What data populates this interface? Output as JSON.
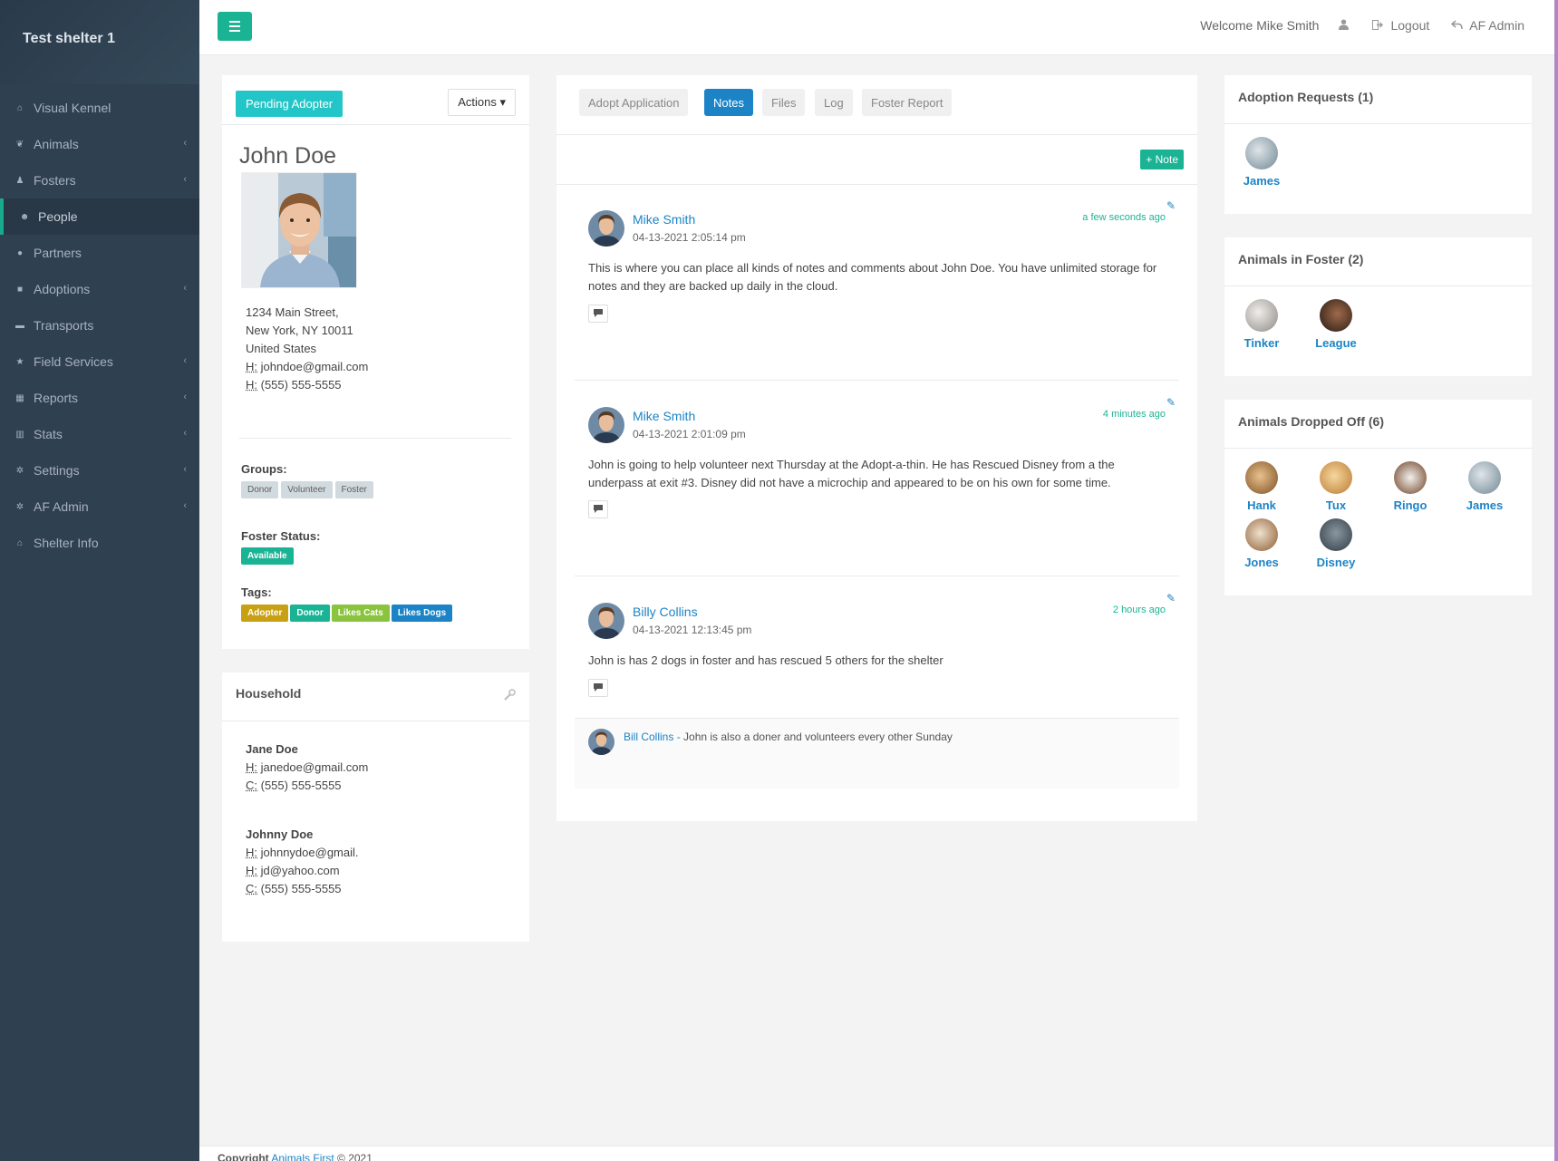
{
  "app": {
    "title": "Test shelter 1"
  },
  "sidebar": {
    "items": [
      {
        "label": "Visual Kennel",
        "icon": "home-icon",
        "caret": false
      },
      {
        "label": "Animals",
        "icon": "paw-icon",
        "caret": true
      },
      {
        "label": "Fosters",
        "icon": "child-icon",
        "caret": true
      },
      {
        "label": "People",
        "icon": "users-icon",
        "caret": false,
        "active": true
      },
      {
        "label": "Partners",
        "icon": "user-icon",
        "caret": false
      },
      {
        "label": "Adoptions",
        "icon": "gift-icon",
        "caret": true
      },
      {
        "label": "Transports",
        "icon": "truck-icon",
        "caret": false
      },
      {
        "label": "Field Services",
        "icon": "star-icon",
        "caret": true
      },
      {
        "label": "Reports",
        "icon": "table-icon",
        "caret": true
      },
      {
        "label": "Stats",
        "icon": "bar-chart-icon",
        "caret": true
      },
      {
        "label": "Settings",
        "icon": "gear-icon",
        "caret": true
      },
      {
        "label": "AF Admin",
        "icon": "gear-icon",
        "caret": true
      },
      {
        "label": "Shelter Info",
        "icon": "home-icon",
        "caret": false
      }
    ]
  },
  "topbar": {
    "welcome": "Welcome Mike Smith",
    "logout": "Logout",
    "admin": "AF Admin"
  },
  "profile": {
    "status": "Pending Adopter",
    "actions": "Actions",
    "name": "John Doe",
    "address": {
      "line1": "1234 Main Street,",
      "line2": "New York, NY 10011",
      "line3": "United States",
      "email_key": "H:",
      "email": "johndoe@gmail.com",
      "phone_key": "H:",
      "phone": "(555) 555-5555"
    },
    "groups_label": "Groups:",
    "groups": [
      "Donor",
      "Volunteer",
      "Foster"
    ],
    "foster_status_label": "Foster Status:",
    "foster_status": "Available",
    "tags_label": "Tags:",
    "tags": [
      {
        "label": "Adopter",
        "color": "#c7a014"
      },
      {
        "label": "Donor",
        "color": "#1ab394"
      },
      {
        "label": "Likes Cats",
        "color": "#8ac33d"
      },
      {
        "label": "Likes Dogs",
        "color": "#1c84c6"
      }
    ]
  },
  "household": {
    "title": "Household",
    "members": [
      {
        "name": "Jane Doe",
        "lines": [
          [
            "H:",
            "janedoe@gmail.com"
          ],
          [
            "C:",
            "(555) 555-5555"
          ]
        ]
      },
      {
        "name": "Johnny Doe",
        "lines": [
          [
            "H:",
            "johnnydoe@gmail."
          ],
          [
            "H:",
            "jd@yahoo.com"
          ],
          [
            "C:",
            "(555) 555-5555"
          ]
        ]
      }
    ]
  },
  "tabs": [
    {
      "label": "Adopt Application",
      "active": false
    },
    {
      "label": "Notes",
      "active": true
    },
    {
      "label": "Files",
      "active": false
    },
    {
      "label": "Log",
      "active": false
    },
    {
      "label": "Foster Report",
      "active": false
    }
  ],
  "notes": {
    "add_label": "+ Note",
    "items": [
      {
        "author": "Mike Smith",
        "date": "04-13-2021 2:05:14 pm",
        "ago": "a few seconds ago",
        "body": "This is where you can place all kinds of notes and comments about John Doe. You have unlimited storage for notes and they are backed up daily in the cloud."
      },
      {
        "author": "Mike Smith",
        "date": "04-13-2021 2:01:09 pm",
        "ago": "4 minutes ago",
        "body": "John is going to help volunteer next Thursday at the Adopt-a-thin. He has Rescued Disney from a the underpass at exit #3. Disney did not have a microchip and appeared to be on his own for some time."
      },
      {
        "author": "Billy Collins",
        "date": "04-13-2021 12:13:45 pm",
        "ago": "2 hours ago",
        "body": "John is has 2 dogs in foster and has rescued 5 others for the shelter"
      }
    ],
    "comment": {
      "author": "Bill Collins",
      "sep": " - ",
      "text": "John is also a doner and volunteers every other Sunday"
    }
  },
  "adoption_requests": {
    "title": "Adoption Requests (1)",
    "animals": [
      "James"
    ]
  },
  "animals_in_foster": {
    "title": "Animals in Foster (2)",
    "animals": [
      "Tinker",
      "League"
    ]
  },
  "animals_dropped_off": {
    "title": "Animals Dropped Off (6)",
    "animals": [
      "Hank",
      "Tux",
      "Ringo",
      "James",
      "Jones",
      "Disney"
    ]
  },
  "footer": {
    "prefix": "Copyright",
    "link": "Animals First",
    "suffix": "© 2021"
  }
}
